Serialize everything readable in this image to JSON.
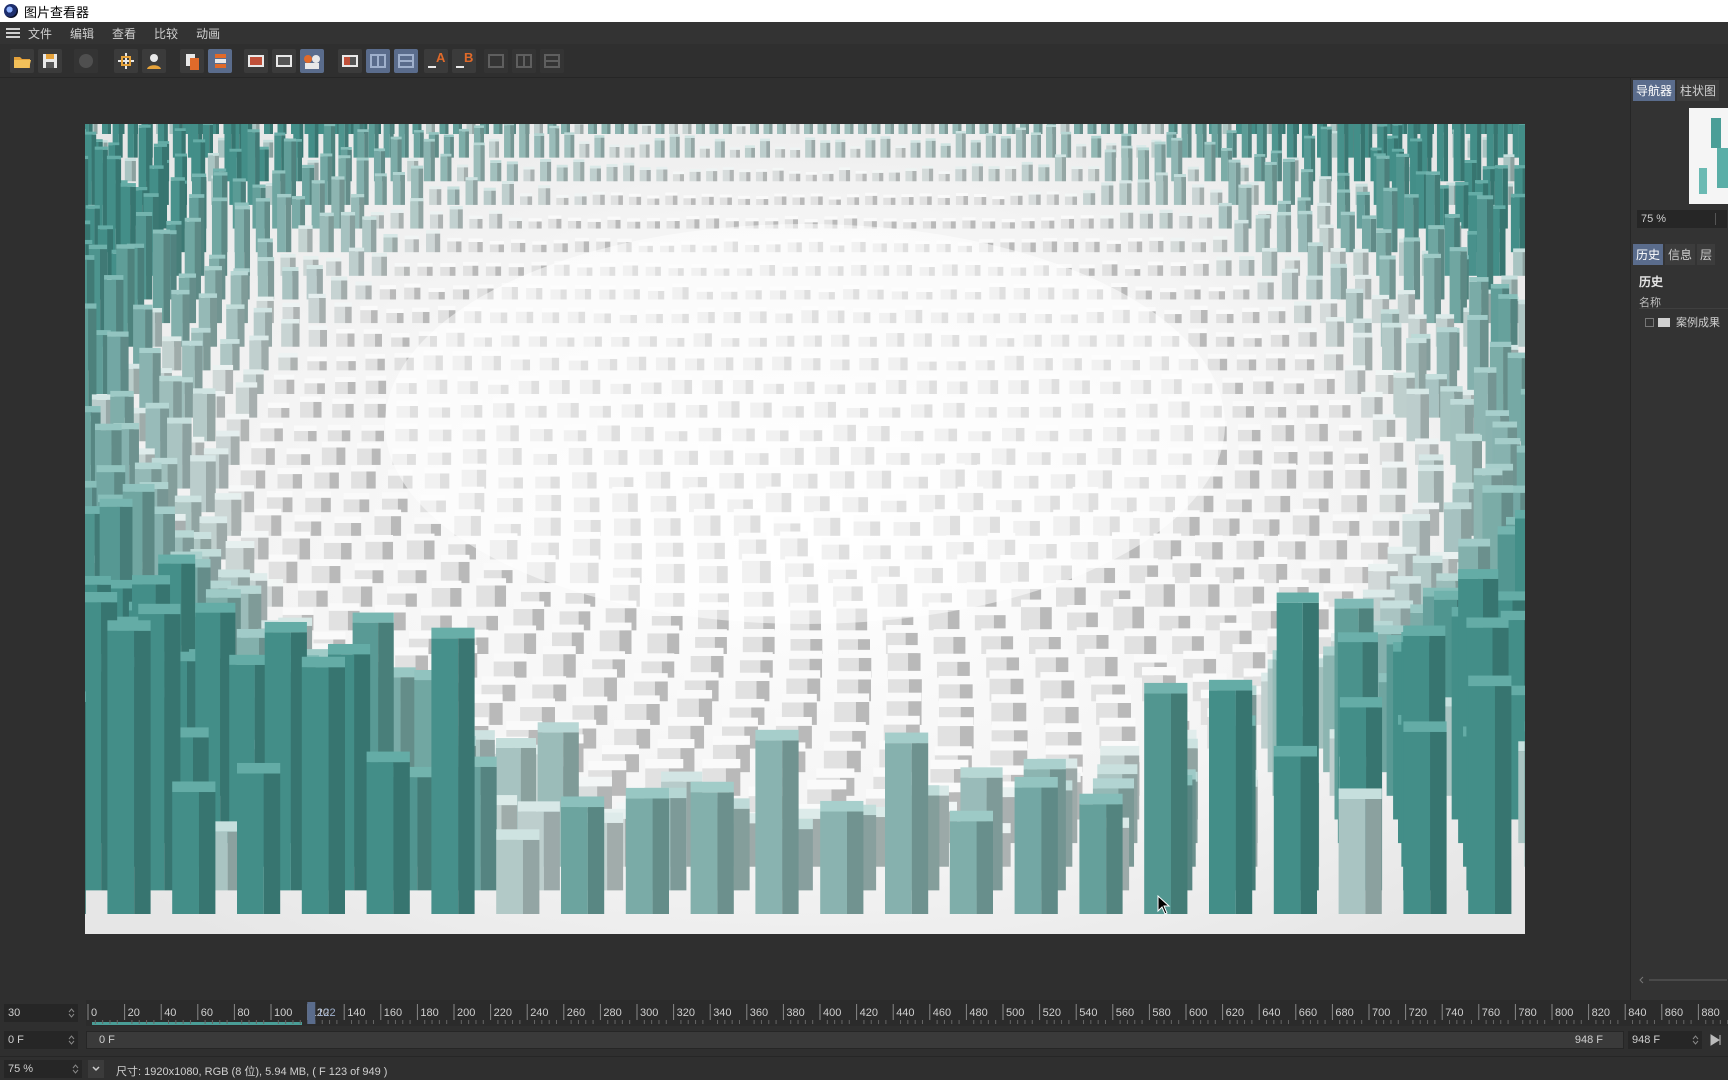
{
  "window": {
    "title": "图片查看器"
  },
  "menu": {
    "items": [
      "文件",
      "编辑",
      "查看",
      "比较",
      "动画"
    ]
  },
  "toolbar": {
    "buttons": [
      {
        "name": "open-file",
        "icon": "folder-open-icon"
      },
      {
        "name": "save-file",
        "icon": "save-icon"
      },
      {
        "name": "stop-render",
        "icon": "stop-icon"
      },
      {
        "name": "zoom-fit",
        "icon": "crosshair-icon"
      },
      {
        "name": "user-view",
        "icon": "user-icon"
      },
      {
        "name": "copy-frame",
        "icon": "copy-icon"
      },
      {
        "name": "layers",
        "icon": "layers-icon"
      },
      {
        "name": "view-mode-1",
        "icon": "display-icon"
      },
      {
        "name": "view-mode-2",
        "icon": "display-icon"
      },
      {
        "name": "view-mode-3",
        "icon": "display-group-icon"
      },
      {
        "name": "compare-ab",
        "icon": "ab-icon"
      },
      {
        "name": "split-1",
        "icon": "split-icon"
      },
      {
        "name": "split-2",
        "icon": "split-icon"
      },
      {
        "name": "set-a",
        "icon": "set-a-icon",
        "letter": "A"
      },
      {
        "name": "set-b",
        "icon": "set-b-icon",
        "letter": "B"
      },
      {
        "name": "swap-1",
        "icon": "swap-icon"
      },
      {
        "name": "swap-2",
        "icon": "swap-icon"
      },
      {
        "name": "swap-3",
        "icon": "swap-icon"
      }
    ]
  },
  "right_panel": {
    "top_tabs": [
      "导航器",
      "柱状图"
    ],
    "zoom": "75 %",
    "bottom_tabs": [
      "历史",
      "信息",
      "层"
    ],
    "history_title": "历史",
    "column_header": "名称",
    "row_label": "案例成果"
  },
  "timeline": {
    "fps": "30",
    "current_frame": "0 F",
    "scrub_start": "0 F",
    "scrub_end": "948 F",
    "end_field": "948 F",
    "playhead_label": "122",
    "ruler_ticks": [
      0,
      20,
      40,
      60,
      80,
      100,
      120,
      140,
      160,
      180,
      200,
      220,
      240,
      260,
      280,
      300,
      320,
      340,
      360,
      380,
      400,
      420,
      440,
      460,
      480,
      500,
      520,
      540,
      560,
      580,
      600,
      620,
      640,
      660,
      680,
      700,
      720,
      740,
      760,
      780,
      800,
      820,
      840,
      860,
      880
    ]
  },
  "status": {
    "zoom": "75 %",
    "info": "尺寸: 1920x1080, RGB (8 位), 5.94 MB,  ( F 123 of 949 )"
  },
  "colors": {
    "accent": "#5a6c8c",
    "teal": "#4a9e97",
    "background": "#2f2f2f"
  }
}
